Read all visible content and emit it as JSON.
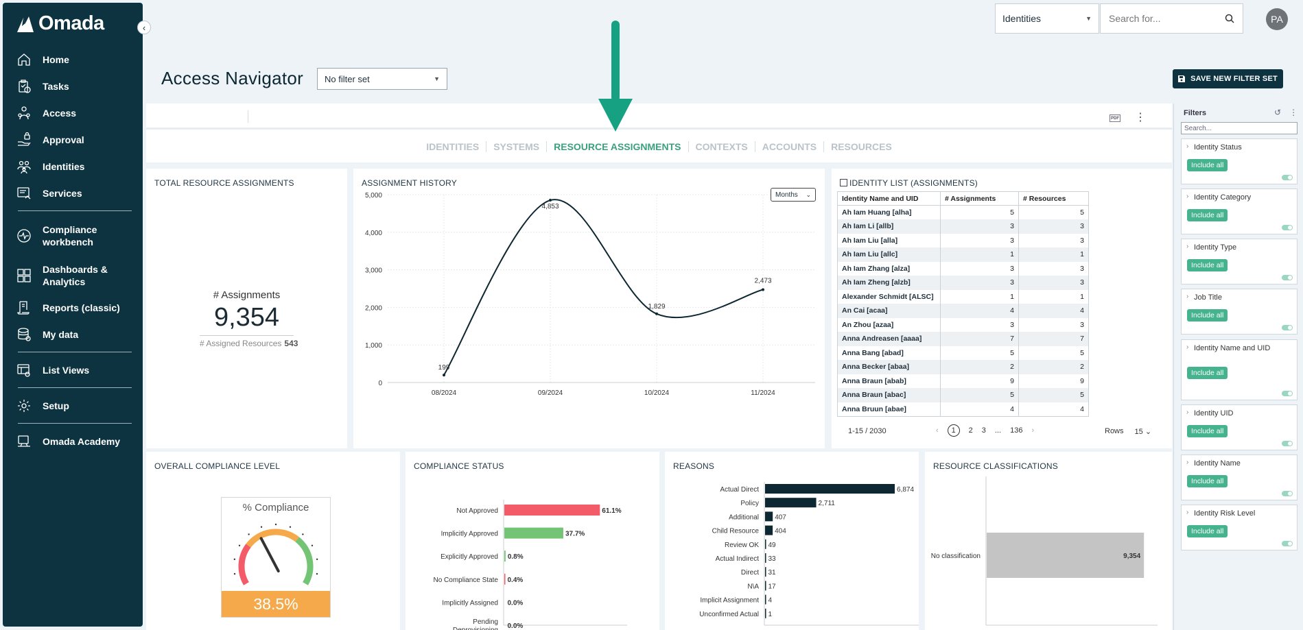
{
  "app": {
    "logo_text": "Omada"
  },
  "sidebar": {
    "items": [
      {
        "label": "Home"
      },
      {
        "label": "Tasks"
      },
      {
        "label": "Access"
      },
      {
        "label": "Approval"
      },
      {
        "label": "Identities"
      },
      {
        "label": "Services"
      },
      {
        "label": "Compliance workbench"
      },
      {
        "label": "Dashboards & Analytics"
      },
      {
        "label": "Reports (classic)"
      },
      {
        "label": "My data"
      },
      {
        "label": "List Views"
      },
      {
        "label": "Setup"
      },
      {
        "label": "Omada Academy"
      }
    ]
  },
  "topbar": {
    "scope_select": "Identities",
    "search_placeholder": "Search for...",
    "avatar_initials": "PA"
  },
  "page": {
    "title": "Access Navigator",
    "filter_select": "No filter set",
    "save_button": "SAVE NEW FILTER SET",
    "pdf_label": "PDF"
  },
  "tabs": [
    {
      "label": "IDENTITIES",
      "active": false
    },
    {
      "label": "SYSTEMS",
      "active": false
    },
    {
      "label": "RESOURCE ASSIGNMENTS",
      "active": true
    },
    {
      "label": "CONTEXTS",
      "active": false
    },
    {
      "label": "ACCOUNTS",
      "active": false
    },
    {
      "label": "RESOURCES",
      "active": false
    }
  ],
  "total": {
    "title": "TOTAL RESOURCE ASSIGNMENTS",
    "label": "# Assignments",
    "value": "9,354",
    "sub_label": "# Assigned Resources",
    "sub_value": "543"
  },
  "history": {
    "title": "ASSIGNMENT HISTORY",
    "period_select": "Months"
  },
  "identity_list": {
    "title": "IDENTITY LIST (ASSIGNMENTS)",
    "columns": [
      "Identity Name and UID",
      "# Assignments",
      "# Resources"
    ],
    "rows": [
      [
        "Ah Iam Huang [alha]",
        "5",
        "5"
      ],
      [
        "Ah Iam Li [allb]",
        "3",
        "3"
      ],
      [
        "Ah Iam Liu [alla]",
        "3",
        "3"
      ],
      [
        "Ah Iam Liu [allc]",
        "1",
        "1"
      ],
      [
        "Ah Iam Zhang [alza]",
        "3",
        "3"
      ],
      [
        "Ah Iam Zheng [alzb]",
        "3",
        "3"
      ],
      [
        "Alexander Schmidt [ALSC]",
        "1",
        "1"
      ],
      [
        "An Cai [acaa]",
        "4",
        "4"
      ],
      [
        "An Zhou [azaa]",
        "3",
        "3"
      ],
      [
        "Anna Andreasen [aaaa]",
        "7",
        "7"
      ],
      [
        "Anna Bang [abad]",
        "5",
        "5"
      ],
      [
        "Anna Becker [abaa]",
        "2",
        "2"
      ],
      [
        "Anna Braun [abab]",
        "9",
        "9"
      ],
      [
        "Anna Braun [abac]",
        "5",
        "5"
      ],
      [
        "Anna Bruun [abae]",
        "4",
        "4"
      ]
    ],
    "pager": {
      "range": "1-15 / 2030",
      "prev": "‹",
      "pages": [
        "1",
        "2",
        "3",
        "...",
        "136"
      ],
      "next": "›",
      "rows_label": "Rows",
      "rows_value": "15"
    }
  },
  "compliance_level": {
    "title": "OVERALL COMPLIANCE LEVEL",
    "gauge_label": "% Compliance",
    "gauge_value": "38.5%",
    "gauge_fraction": 0.385
  },
  "compliance_status": {
    "title": "COMPLIANCE STATUS"
  },
  "reasons": {
    "title": "REASONS"
  },
  "classifications": {
    "title": "RESOURCE CLASSIFICATIONS"
  },
  "filters": {
    "title": "Filters",
    "search_placeholder": "Search...",
    "include_label": "Include all",
    "items": [
      {
        "name": "Identity Status"
      },
      {
        "name": "Identity Category"
      },
      {
        "name": "Identity Type"
      },
      {
        "name": "Job Title"
      },
      {
        "name": "Identity Name and UID"
      },
      {
        "name": "Identity UID"
      },
      {
        "name": "Identity Name"
      },
      {
        "name": "Identity Risk Level"
      }
    ]
  },
  "colors": {
    "sidebar_bg": "#0d3340",
    "accent_green": "#3ba07d",
    "include_green": "#45b38d",
    "not_approved_red": "#f45b69",
    "approved_green": "#74c476",
    "reasons_navy": "#0d2733",
    "gauge_orange": "#f5a94a",
    "classification_gray": "#c4c4c4"
  },
  "chart_data": [
    {
      "type": "line",
      "x": [
        "08/2024",
        "09/2024",
        "10/2024",
        "11/2024"
      ],
      "values": [
        199,
        4853,
        1829,
        2473
      ],
      "data_labels": [
        "199",
        "4,853",
        "1,829",
        "2,473"
      ],
      "y_ticks": [
        "0",
        "1,000",
        "2,000",
        "3,000",
        "4,000",
        "5,000"
      ],
      "ylim": [
        0,
        5000
      ],
      "grid": true
    },
    {
      "type": "bar",
      "orientation": "horizontal",
      "categories": [
        "Not Approved",
        "Implicitly Approved",
        "Explicitly Approved",
        "No Compliance State",
        "Implicitly Assigned",
        "Pending Deprovisioning"
      ],
      "values": [
        61.1,
        37.7,
        0.8,
        0.4,
        0.0,
        0.0
      ],
      "data_labels": [
        "61.1%",
        "37.7%",
        "0.8%",
        "0.4%",
        "0.0%",
        "0.0%"
      ],
      "colors": [
        "#f45b69",
        "#74c476",
        "#74c476",
        "#f45b69",
        "#999999",
        "#999999"
      ],
      "xlim": [
        0,
        100
      ]
    },
    {
      "type": "bar",
      "orientation": "horizontal",
      "categories": [
        "Actual Direct",
        "Policy",
        "Additional",
        "Child Resource",
        "Review OK",
        "Actual Indirect",
        "Direct",
        "N\\A",
        "Implicit Assignment",
        "Unconfirmed Actual"
      ],
      "values": [
        6874,
        2711,
        407,
        404,
        49,
        33,
        31,
        17,
        4,
        1
      ],
      "data_labels": [
        "6,874",
        "2,711",
        "407",
        "404",
        "49",
        "33",
        "31",
        "17",
        "4",
        "1"
      ],
      "xlim": [
        0,
        8000
      ]
    },
    {
      "type": "bar",
      "orientation": "horizontal",
      "categories": [
        "No classification"
      ],
      "values": [
        9354
      ],
      "data_labels": [
        "9,354"
      ],
      "xlim": [
        0,
        10000
      ]
    }
  ]
}
